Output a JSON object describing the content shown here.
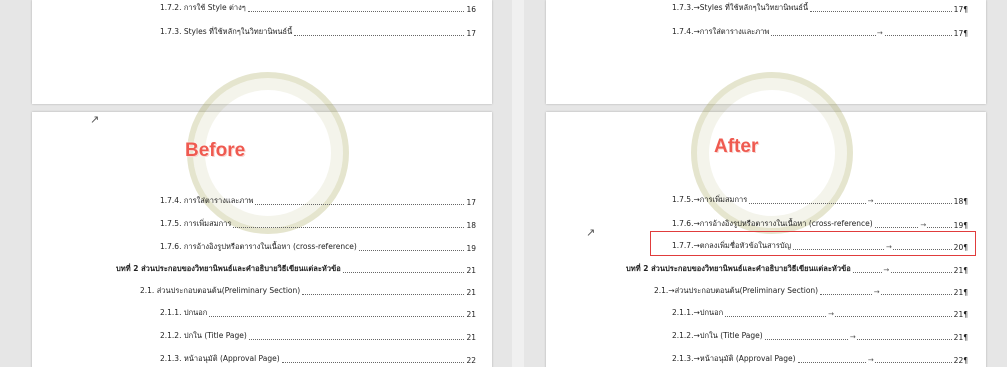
{
  "before": {
    "label": "Before",
    "top_entries": [
      {
        "text": "1.7.2.  การใช้ Style ต่างๆ",
        "page": "16"
      },
      {
        "text": "1.7.3.  Styles ที่ใช้หลักๆในวิทยานิพนธ์นี้",
        "page": "17"
      }
    ],
    "bottom_entries": [
      {
        "text": "1.7.4.  การใส่ตารางและภาพ",
        "page": "17"
      },
      {
        "text": "1.7.5.  การเพิ่มสมการ",
        "page": "18"
      },
      {
        "text": "1.7.6.  การอ้างอิงรูปหรือตารางในเนื้อหา (cross-reference)",
        "page": "19"
      },
      {
        "text": "บทที่ 2 ส่วนประกอบของวิทยานิพนธ์และคำอธิบายวิธีเขียนแต่ละหัวข้อ",
        "page": "21"
      },
      {
        "text": "2.1.  ส่วนประกอบตอนต้น(Preliminary Section)",
        "page": "21"
      },
      {
        "text": "2.1.1.  ปกนอก",
        "page": "21"
      },
      {
        "text": "2.1.2.  ปกใน (Title Page)",
        "page": "21"
      },
      {
        "text": "2.1.3.  หน้าอนุมัติ (Approval Page)",
        "page": "22"
      }
    ]
  },
  "after": {
    "label": "After",
    "top_entries": [
      {
        "text": "1.7.3.→Styles ที่ใช้หลักๆในวิทยานิพนธ์นี้",
        "page": "17¶"
      },
      {
        "text": "1.7.4.→การใส่ตารางและภาพ",
        "page": "17¶"
      }
    ],
    "bottom_entries": [
      {
        "text": "1.7.5.→การเพิ่มสมการ",
        "page": "18¶"
      },
      {
        "text": "1.7.6.→การอ้างอิงรูปหรือตารางในเนื้อหา (cross-reference)",
        "page": "19¶"
      },
      {
        "text": "1.7.7.→ตกลงเพิ่มชื่อหัวข้อในสารบัญ",
        "page": "20¶"
      },
      {
        "text": "บทที่ 2 ส่วนประกอบของวิทยานิพนธ์และคำอธิบายวิธีเขียนแต่ละหัวข้อ",
        "page": "21¶"
      },
      {
        "text": "2.1.→ส่วนประกอบตอนต้น(Preliminary Section)",
        "page": "21¶"
      },
      {
        "text": "2.1.1.→ปกนอก",
        "page": "21¶"
      },
      {
        "text": "2.1.2.→ปกใน (Title Page)",
        "page": "21¶"
      },
      {
        "text": "2.1.3.→หน้าอนุมัติ (Approval Page)",
        "page": "22¶"
      }
    ],
    "tab_arrow": "→"
  },
  "colors": {
    "label": "#ef5a50",
    "highlight_box": "#e03c3c",
    "page": "#ffffff",
    "background": "#e6e6e6"
  }
}
